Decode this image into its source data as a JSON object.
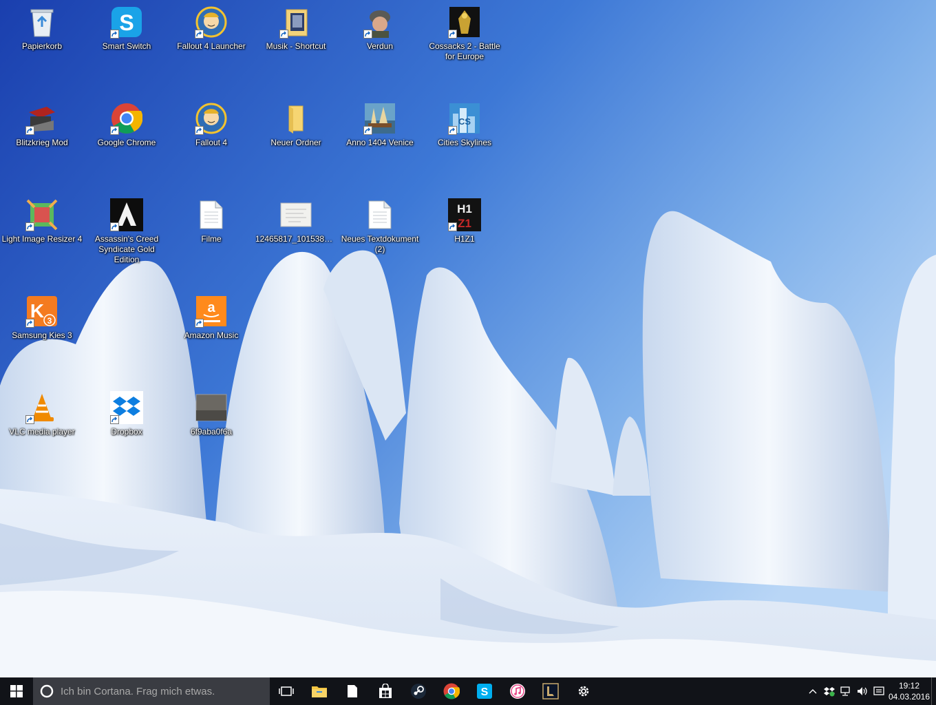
{
  "desktop": {
    "icons": [
      {
        "id": "papierkorb",
        "label": "Papierkorb"
      },
      {
        "id": "smart-switch",
        "label": "Smart Switch"
      },
      {
        "id": "fallout4-launcher",
        "label": "Fallout 4 Launcher"
      },
      {
        "id": "musik-shortcut",
        "label": "Musik - Shortcut"
      },
      {
        "id": "verdun",
        "label": "Verdun"
      },
      {
        "id": "cossacks2",
        "label": "Cossacks 2 - Battle for Europe"
      },
      {
        "id": "blitzkrieg-mod",
        "label": "Blitzkrieg Mod"
      },
      {
        "id": "google-chrome",
        "label": "Google Chrome"
      },
      {
        "id": "fallout4",
        "label": "Fallout 4"
      },
      {
        "id": "neuer-ordner",
        "label": "Neuer Ordner"
      },
      {
        "id": "anno1404",
        "label": "Anno 1404 Venice"
      },
      {
        "id": "cities-skylines",
        "label": "Cities Skylines"
      },
      {
        "id": "light-image-resizer",
        "label": "Light Image Resizer 4"
      },
      {
        "id": "assassins-creed",
        "label": "Assassin's Creed Syndicate Gold Edition"
      },
      {
        "id": "filme",
        "label": "Filme"
      },
      {
        "id": "image-file",
        "label": "12465817_101538683..."
      },
      {
        "id": "neues-textdokument",
        "label": "Neues Textdokument (2)"
      },
      {
        "id": "h1z1",
        "label": "H1Z1"
      },
      {
        "id": "samsung-kies",
        "label": "Samsung Kies 3"
      },
      {
        "id": "amazon-music",
        "label": "Amazon Music"
      },
      {
        "id": "vlc",
        "label": "VLC media player"
      },
      {
        "id": "dropbox",
        "label": "Dropbox"
      },
      {
        "id": "photo-file",
        "label": "6f9aba0f6a"
      }
    ]
  },
  "taskbar": {
    "search_placeholder": "Ich bin Cortana. Frag mich etwas.",
    "pinned": [
      "task-view",
      "file-explorer",
      "notepad-document",
      "windows-store",
      "steam",
      "google-chrome",
      "skype",
      "itunes",
      "league-of-legends",
      "settings"
    ],
    "clock_time": "19:12",
    "clock_date": "04.03.2016"
  },
  "colors": {
    "taskbar_bg": "#111318",
    "search_bg": "#3a3c42",
    "sky_top": "#1f4fb8",
    "sky_bottom": "#8fb8ec",
    "snow": "#eef3fb"
  }
}
